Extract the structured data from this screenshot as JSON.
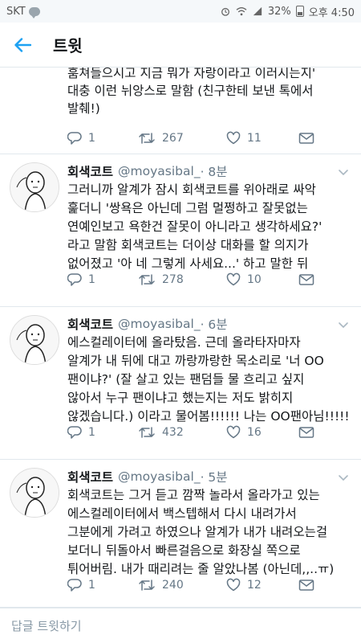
{
  "status_bar": {
    "carrier": "SKT",
    "battery": "32%",
    "time": "오후 4:50"
  },
  "header": {
    "title": "트윗",
    "back_icon": "arrow-left-icon"
  },
  "accent_color": "#1da1f2",
  "partial_tweet": {
    "text": "훔쳐들으시고 지금 뭐가 자랑이라고 이러시는지'\n대충 이런 뉘앙스로 말함 (친구한테 보낸 톡에서\n발췌!)",
    "replies": "1",
    "retweets": "267",
    "likes": "11"
  },
  "tweets": [
    {
      "name": "회색코트",
      "handle": "@moyasibal_",
      "time": "· 8분",
      "text": "그러니까 알계가 잠시 회색코트를 위아래로 싸악\n훑더니 '쌍욕은 아닌데 그럼 멀쩡하고 잘못없는\n연예인보고 욕한건 잘못이 아니라고 생각하세요?'\n라고 말함 회색코트는 더이상 대화를 할 의지가\n없어졌고 '아 네 그렇게 사세요...' 하고 말한 뒤",
      "replies": "1",
      "retweets": "278",
      "likes": "10"
    },
    {
      "name": "회색코트",
      "handle": "@moyasibal_",
      "time": "· 6분",
      "text": "에스컬레이터에 올라탔음. 근데 올라타자마자\n알계가 내 뒤에 대고 까랑까랑한 목소리로 '너 OO\n팬이냐?' (잘 살고 있는 팬덤들 물 흐리고 싶지\n않아서 누구 팬이냐고 했는지는 저도 밝히지\n않겠습니다.) 이라고 물어봄!!!!!! 나는 OO팬아님!!!!!",
      "replies": "1",
      "retweets": "432",
      "likes": "16"
    },
    {
      "name": "회색코트",
      "handle": "@moyasibal_",
      "time": "· 5분",
      "text": "회색코트는 그거 듣고 깜짝 놀라서 올라가고 있는\n에스컬레이터에서 백스텝해서 다시 내려가서\n그분에게 가려고 하였으나 알계가 내가 내려오는걸\n보더니 뒤돌아서 빠른걸음으로 화장실 쪽으로\n튀어버림. 내가 때리려는 줄 알았나봄 (아닌데,,..ㅠ)",
      "replies": "1",
      "retweets": "240",
      "likes": "12"
    }
  ],
  "reply_bar": {
    "placeholder": "답글 트윗하기"
  }
}
